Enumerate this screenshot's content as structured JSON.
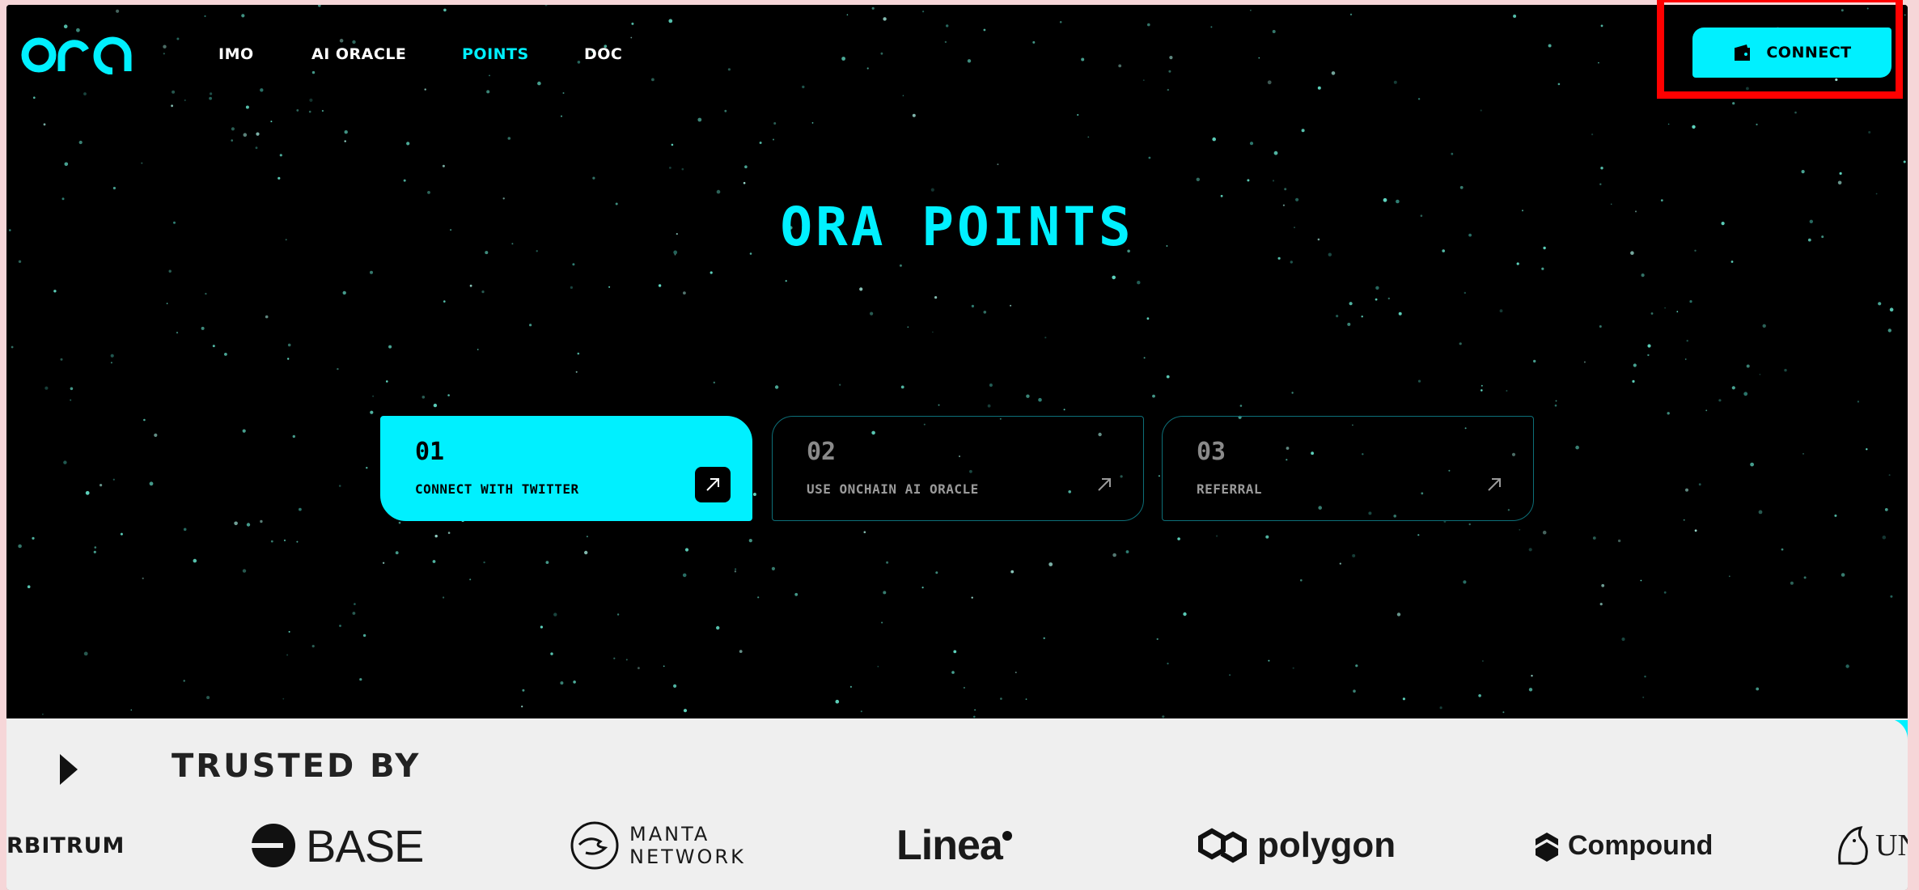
{
  "nav": {
    "items": [
      {
        "label": "IMO",
        "active": false
      },
      {
        "label": "AI ORACLE",
        "active": false
      },
      {
        "label": "POINTS",
        "active": true
      },
      {
        "label": "DOC",
        "active": false
      }
    ],
    "connect_label": "CONNECT"
  },
  "hero": {
    "title": "ORA POINTS"
  },
  "cards": [
    {
      "num": "01",
      "label": "CONNECT WITH TWITTER",
      "active": true
    },
    {
      "num": "02",
      "label": "USE ONCHAIN AI ORACLE",
      "active": false
    },
    {
      "num": "03",
      "label": "REFERRAL",
      "active": false
    }
  ],
  "trusted": {
    "title": "TRUSTED BY",
    "partners": [
      "RBITRUM",
      "BASE",
      "MANTA",
      "NETWORK",
      "Linea",
      "polygon",
      "Compound",
      "UN"
    ]
  },
  "colors": {
    "accent": "#00f0ff",
    "background": "#000000",
    "highlight": "#ff0000"
  }
}
